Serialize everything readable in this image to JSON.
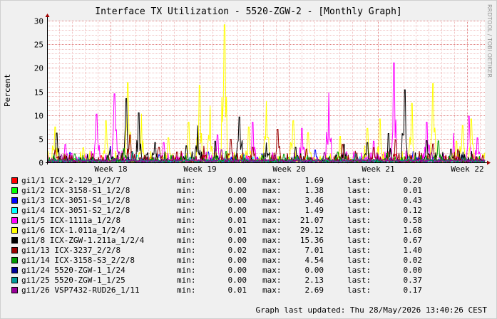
{
  "title": "Interface TX Utilization - 5520-ZGW-2 - [Monthly Graph]",
  "watermark": "RRDTOOL / TOBI OETIKER",
  "footer": "Graph last updated: Thu 28/May/2026 13:40:26 CEST",
  "legend_labels": {
    "min": "min:",
    "max": "max:",
    "last": "last:"
  },
  "chart_data": {
    "type": "line",
    "ylabel": "Percent",
    "ylim": [
      0,
      30
    ],
    "yticks": [
      0,
      5,
      10,
      15,
      20,
      25,
      30
    ],
    "xlim": [
      17.3,
      22.2
    ],
    "xticks": [
      {
        "value": 18,
        "label": "Week 18"
      },
      {
        "value": 19,
        "label": "Week 19"
      },
      {
        "value": 20,
        "label": "Week 20"
      },
      {
        "value": 21,
        "label": "Week 21"
      },
      {
        "value": 22,
        "label": "Week 22"
      }
    ],
    "grid": true,
    "series": [
      {
        "name": "gi1/1 ICX-2-129_1/2/7",
        "color": "#ff0000",
        "min": "0.00",
        "max": "1.69",
        "last": "0.20",
        "peaks": [
          [
            17.42,
            1.2
          ],
          [
            17.9,
            1.4
          ],
          [
            18.45,
            1.1
          ],
          [
            19.05,
            1.5
          ],
          [
            19.55,
            1.3
          ],
          [
            20.1,
            1.0
          ],
          [
            20.6,
            1.4
          ],
          [
            21.2,
            1.69
          ],
          [
            21.75,
            1.2
          ],
          [
            22.15,
            0.2
          ]
        ]
      },
      {
        "name": "gi1/2 ICX-3158-S1_1/2/8",
        "color": "#00ff00",
        "min": "0.00",
        "max": "1.38",
        "last": "0.01",
        "peaks": [
          [
            17.6,
            0.8
          ],
          [
            18.2,
            1.1
          ],
          [
            18.8,
            1.38
          ],
          [
            19.4,
            0.9
          ],
          [
            20.0,
            1.0
          ],
          [
            20.7,
            0.7
          ],
          [
            21.3,
            1.2
          ],
          [
            21.9,
            0.6
          ]
        ]
      },
      {
        "name": "gi1/3 ICX-3051-S4_1/2/8",
        "color": "#0000ff",
        "min": "0.00",
        "max": "3.46",
        "last": "0.43",
        "peaks": [
          [
            17.55,
            2.1
          ],
          [
            18.0,
            3.46
          ],
          [
            18.55,
            1.6
          ],
          [
            19.1,
            2.2
          ],
          [
            19.7,
            1.8
          ],
          [
            20.3,
            2.6
          ],
          [
            20.9,
            1.9
          ],
          [
            21.4,
            2.3
          ],
          [
            21.95,
            1.5
          ],
          [
            22.18,
            0.43
          ]
        ]
      },
      {
        "name": "gi1/4 ICX-3051-S2_1/2/8",
        "color": "#00ffff",
        "min": "0.00",
        "max": "1.49",
        "last": "0.12",
        "peaks": [
          [
            17.7,
            1.0
          ],
          [
            18.3,
            1.49
          ],
          [
            18.9,
            0.8
          ],
          [
            19.6,
            1.1
          ],
          [
            20.2,
            0.9
          ],
          [
            20.8,
            1.3
          ],
          [
            21.5,
            1.0
          ],
          [
            22.0,
            0.7
          ]
        ]
      },
      {
        "name": "gi1/5 ICX-1111a_1/2/8",
        "color": "#ff00ff",
        "min": "0.01",
        "max": "21.07",
        "last": "0.58",
        "peaks": [
          [
            17.5,
            3.8
          ],
          [
            17.85,
            10.2
          ],
          [
            18.05,
            14.5
          ],
          [
            18.6,
            4.2
          ],
          [
            19.2,
            5.8
          ],
          [
            19.6,
            8.5
          ],
          [
            20.15,
            7.2
          ],
          [
            20.45,
            14.8
          ],
          [
            20.65,
            2.1
          ],
          [
            20.95,
            4.5
          ],
          [
            21.18,
            21.07
          ],
          [
            21.55,
            8.5
          ],
          [
            21.85,
            6.2
          ],
          [
            22.02,
            9.8
          ],
          [
            22.12,
            5.2
          ],
          [
            22.18,
            0.58
          ]
        ]
      },
      {
        "name": "gi1/6 ICX-1.011a_1/2/4",
        "color": "#ffff00",
        "min": "0.01",
        "max": "29.12",
        "last": "1.68",
        "peaks": [
          [
            17.38,
            7.5
          ],
          [
            17.7,
            3.1
          ],
          [
            17.95,
            8.8
          ],
          [
            18.2,
            16.9
          ],
          [
            18.35,
            10.3
          ],
          [
            18.65,
            5.2
          ],
          [
            18.88,
            8.5
          ],
          [
            19.0,
            16.3
          ],
          [
            19.12,
            12.0
          ],
          [
            19.28,
            29.12
          ],
          [
            19.55,
            7.5
          ],
          [
            19.75,
            13.0
          ],
          [
            20.05,
            8.8
          ],
          [
            20.22,
            6.3
          ],
          [
            20.58,
            5.5
          ],
          [
            20.88,
            7.2
          ],
          [
            21.02,
            9.2
          ],
          [
            21.38,
            12.5
          ],
          [
            21.62,
            16.7
          ],
          [
            21.88,
            4.5
          ],
          [
            21.95,
            7.8
          ],
          [
            22.05,
            9.2
          ],
          [
            22.18,
            1.68
          ]
        ]
      },
      {
        "name": "gi1/8 ICX-ZGW-1.211a_1/2/4",
        "color": "#000000",
        "min": "0.00",
        "max": "15.36",
        "last": "0.67",
        "peaks": [
          [
            17.4,
            6.2
          ],
          [
            18.0,
            2.8
          ],
          [
            18.18,
            13.5
          ],
          [
            18.32,
            10.5
          ],
          [
            18.5,
            4.2
          ],
          [
            18.85,
            3.5
          ],
          [
            18.98,
            7.8
          ],
          [
            19.18,
            4.5
          ],
          [
            19.45,
            9.6
          ],
          [
            19.75,
            4.2
          ],
          [
            20.08,
            3.2
          ],
          [
            20.62,
            3.8
          ],
          [
            20.88,
            4.2
          ],
          [
            21.12,
            6.1
          ],
          [
            21.3,
            15.36
          ],
          [
            21.55,
            4.6
          ],
          [
            21.82,
            2.8
          ],
          [
            22.15,
            0.67
          ]
        ]
      },
      {
        "name": "gi1/13 ICX-3237_2/2/8",
        "color": "#990000",
        "min": "0.02",
        "max": "7.01",
        "last": "1.40",
        "peaks": [
          [
            17.38,
            2.6
          ],
          [
            17.8,
            1.8
          ],
          [
            18.22,
            5.8
          ],
          [
            18.55,
            3.2
          ],
          [
            18.75,
            2.2
          ],
          [
            19.05,
            3.5
          ],
          [
            19.35,
            4.9
          ],
          [
            19.6,
            3.2
          ],
          [
            19.88,
            7.01
          ],
          [
            20.2,
            2.8
          ],
          [
            20.6,
            3.8
          ],
          [
            20.95,
            3.1
          ],
          [
            21.2,
            4.8
          ],
          [
            21.62,
            3.9
          ],
          [
            21.9,
            2.7
          ],
          [
            22.18,
            1.4
          ]
        ]
      },
      {
        "name": "gi1/14 ICX-3158-S3_2/2/8",
        "color": "#009900",
        "min": "0.00",
        "max": "4.54",
        "last": "0.02",
        "peaks": [
          [
            17.6,
            1.8
          ],
          [
            18.15,
            2.9
          ],
          [
            18.7,
            1.5
          ],
          [
            19.3,
            2.3
          ],
          [
            19.95,
            1.7
          ],
          [
            20.55,
            2.2
          ],
          [
            21.1,
            1.9
          ],
          [
            21.68,
            4.54
          ],
          [
            22.05,
            1.1
          ]
        ]
      },
      {
        "name": "gi1/24 5520-ZGW-1_1/24",
        "color": "#000099",
        "min": "0.00",
        "max": "0.00",
        "last": "0.00",
        "peaks": []
      },
      {
        "name": "gi1/25 5520-ZGW-1_1/25",
        "color": "#009999",
        "min": "0.00",
        "max": "2.13",
        "last": "0.37",
        "peaks": [
          [
            17.65,
            1.2
          ],
          [
            18.25,
            2.13
          ],
          [
            18.9,
            1.1
          ],
          [
            19.5,
            1.6
          ],
          [
            20.1,
            1.3
          ],
          [
            20.75,
            1.8
          ],
          [
            21.35,
            1.2
          ],
          [
            21.95,
            0.9
          ]
        ]
      },
      {
        "name": "gi1/26 VSP7432-RUD26_1/11",
        "color": "#990099",
        "min": "0.01",
        "max": "2.69",
        "last": "0.17",
        "peaks": [
          [
            17.45,
            1.6
          ],
          [
            18.1,
            2.2
          ],
          [
            18.7,
            1.4
          ],
          [
            19.25,
            2.69
          ],
          [
            19.85,
            1.5
          ],
          [
            20.4,
            2.1
          ],
          [
            21.0,
            1.7
          ],
          [
            21.6,
            2.0
          ],
          [
            22.1,
            0.9
          ]
        ]
      }
    ]
  }
}
